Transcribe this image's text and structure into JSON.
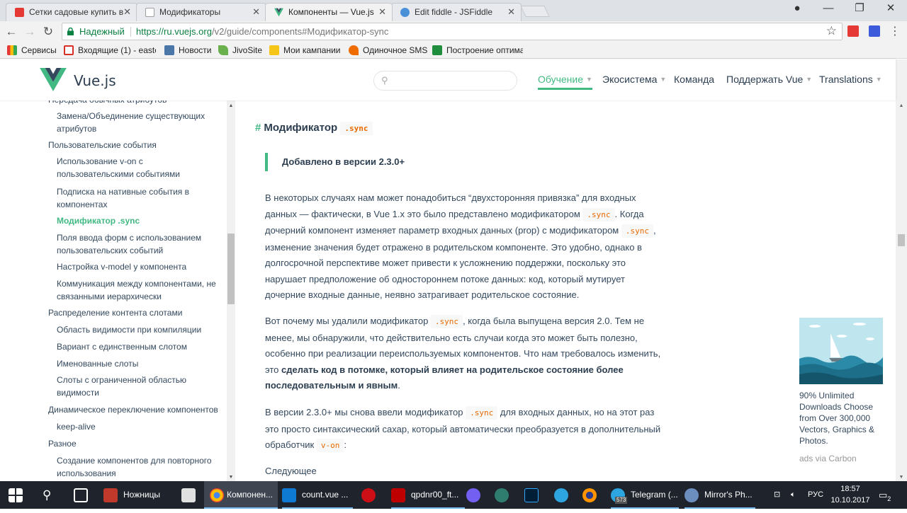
{
  "browser": {
    "tabs": [
      {
        "title": "Сетки садовые купить в",
        "favicon": "#e53935",
        "active": false
      },
      {
        "title": "Модификаторы",
        "favicon": "#9e9e9e",
        "active": false
      },
      {
        "title": "Компоненты — Vue.js",
        "favicon": "#42b983",
        "active": true
      },
      {
        "title": "Edit fiddle - JSFiddle",
        "favicon": "#4a90d9",
        "active": false
      }
    ],
    "address": {
      "secure_label": "Надежный",
      "url_host": "https://ru.vuejs.org",
      "url_path": "/v2/guide/components#Модификатор-sync"
    },
    "bookmarks": [
      {
        "label": "Сервисы",
        "icon": "apps-icon",
        "color": "#e53935"
      },
      {
        "label": "Входящие (1) - easte",
        "icon": "gmail-icon",
        "color": "#d93025"
      },
      {
        "label": "Новости",
        "icon": "vk-icon",
        "color": "#4a76a8"
      },
      {
        "label": "JivoSite",
        "icon": "jivosite-icon",
        "color": "#6ab04c"
      },
      {
        "label": "Мои кампании",
        "icon": "yandex-direct-icon",
        "color": "#f5c518"
      },
      {
        "label": "Одиночное SMS",
        "icon": "sms-icon",
        "color": "#ef6c00"
      },
      {
        "label": "Построение оптима",
        "icon": "sheet-icon",
        "color": "#1e8e3e"
      }
    ]
  },
  "site": {
    "brand": "Vue.js",
    "nav": [
      {
        "label": "Обучение",
        "caret": true,
        "current": true
      },
      {
        "label": "Экосистема",
        "caret": true,
        "current": false
      },
      {
        "label": "Команда",
        "caret": false,
        "current": false
      },
      {
        "label": "Поддержать Vue",
        "caret": true,
        "current": false
      },
      {
        "label": "Translations",
        "caret": true,
        "current": false
      }
    ]
  },
  "sidebar": {
    "items": [
      {
        "text": "Передача обычных атрибутов",
        "level": 1,
        "active": false
      },
      {
        "text": "Замена/Объединение существующих атрибутов",
        "level": 2,
        "active": false
      },
      {
        "text": "Пользовательские события",
        "level": 1,
        "active": false
      },
      {
        "text": "Использование v-on с пользовательскими событиями",
        "level": 2,
        "active": false
      },
      {
        "text": "Подписка на нативные события в компонентах",
        "level": 2,
        "active": false
      },
      {
        "text": "Модификатор .sync",
        "level": 2,
        "active": true
      },
      {
        "text": "Поля ввода форм с использованием пользовательских событий",
        "level": 2,
        "active": false
      },
      {
        "text": "Настройка v-model у компонента",
        "level": 2,
        "active": false
      },
      {
        "text": "Коммуникация между компонентами, не связанными иерархически",
        "level": 2,
        "active": false
      },
      {
        "text": "Распределение контента слотами",
        "level": 1,
        "active": false
      },
      {
        "text": "Область видимости при компиляции",
        "level": 2,
        "active": false
      },
      {
        "text": "Вариант с единственным слотом",
        "level": 2,
        "active": false
      },
      {
        "text": "Именованные слоты",
        "level": 2,
        "active": false
      },
      {
        "text": "Слоты с ограниченной областью видимости",
        "level": 2,
        "active": false
      },
      {
        "text": "Динамическое переключение компонентов",
        "level": 1,
        "active": false
      },
      {
        "text": "keep-alive",
        "level": 2,
        "active": false
      },
      {
        "text": "Разное",
        "level": 1,
        "active": false
      },
      {
        "text": "Создание компонентов для повторного использования",
        "level": 2,
        "active": false
      }
    ]
  },
  "content": {
    "heading": {
      "hash": "#",
      "title": "Модификатор",
      "code": ".sync"
    },
    "tip": "Добавлено в версии 2.3.0+",
    "p1": {
      "t1": "В некоторых случаях нам может понадобиться “двухсторонняя привязка” для входных данных — фактически, в Vue 1.x это было представлено модификатором ",
      "c1": ".sync",
      "t2": ". Когда дочерний компонент изменяет параметр входных данных (prop) с модификатором ",
      "c2": ".sync",
      "t3": ", изменение значения будет отражено в родительском компоненте. Это удобно, однако в долгосрочной перспективе может привести к усложнению поддержки, поскольку это нарушает предположение об одностороннем потоке данных: код, который мутирует дочерние входные данные, неявно затрагивает родительское состояние."
    },
    "p2": {
      "t1": "Вот почему мы удалили модификатор ",
      "c1": ".sync",
      "t2": ", когда была выпущена версия 2.0. Тем не менее, мы обнаружили, что действительно есть случаи когда это может быть полезно, особенно при реализации переиспользуемых компонентов. Что нам требовалось изменить, это ",
      "bold": "сделать код в потомке, который влияет на родительское состояние более последовательным и явным",
      "t3": "."
    },
    "p3": {
      "t1": "В версии 2.3.0+ мы снова ввели модификатор ",
      "c1": ".sync",
      "t2": " для входных данных, но на этот раз это просто синтаксический сахар, который автоматически преобразуется в дополнительный обработчик ",
      "c2": "v-on",
      "t3": ":"
    },
    "next": "Следующее"
  },
  "ad": {
    "text": "90% Unlimited Downloads Choose from Over 300,000 Vectors, Graphics & Photos.",
    "via": "ads via Carbon"
  },
  "taskbar": {
    "apps": [
      {
        "label": "Ножницы",
        "icon": "snipping-tool-icon",
        "color": "#c0392b",
        "open": false,
        "active": false
      },
      {
        "label": "Компонен...",
        "icon": "chrome-icon",
        "color": "#fbbc05",
        "open": true,
        "active": true
      },
      {
        "label": "count.vue ...",
        "icon": "vscode-icon",
        "color": "#0e7ad1",
        "open": true,
        "active": false
      },
      {
        "label": "qpdnr00_ft...",
        "icon": "filezilla-icon",
        "color": "#bf0000",
        "open": true,
        "active": false
      },
      {
        "label": "Telegram (...",
        "icon": "telegram-icon",
        "color": "#2ca5e0",
        "open": true,
        "active": false
      },
      {
        "label": "Mirror's Ph...",
        "icon": "mirror-icon",
        "color": "#6c8ebf",
        "open": true,
        "active": false
      }
    ],
    "telegram_badge": "573",
    "language": "РУС",
    "time": "18:57",
    "date": "10.10.2017",
    "notifications": "2"
  }
}
